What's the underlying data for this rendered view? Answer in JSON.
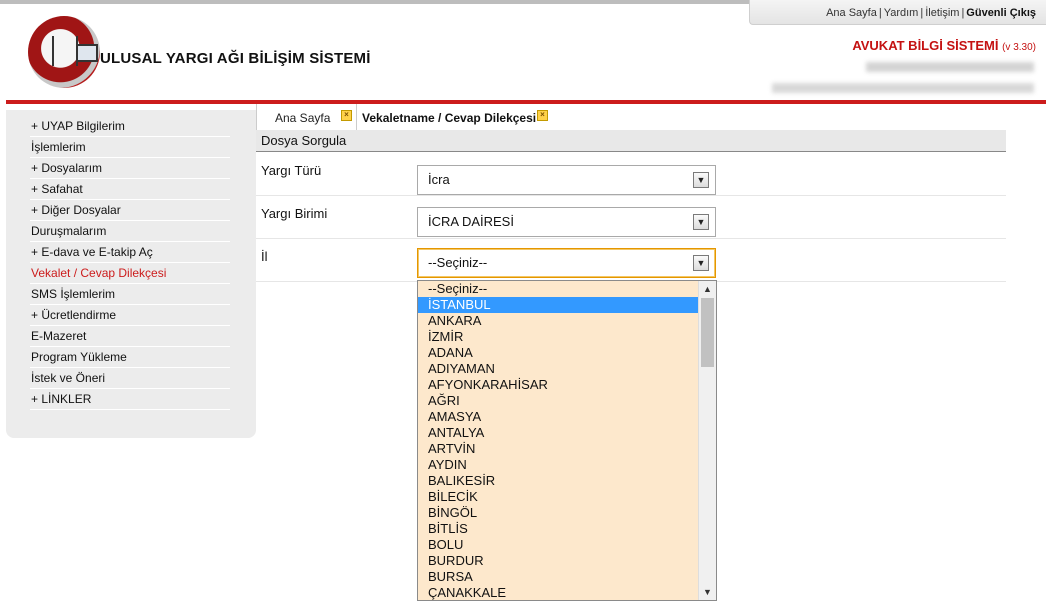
{
  "header": {
    "top_links": [
      "Ana Sayfa",
      "Yardım",
      "İletişim"
    ],
    "logout": "Güvenli Çıkış",
    "site_title": "ULUSAL YARGI AĞI BİLİŞİM SİSTEMİ",
    "app_title": "AVUKAT BİLGİ SİSTEMİ",
    "version": "(v 3.30)"
  },
  "sidebar": {
    "items": [
      "+ UYAP Bilgilerim",
      "İşlemlerim",
      "+ Dosyalarım",
      "+ Safahat",
      "+ Diğer Dosyalar",
      "Duruşmalarım",
      "+ E-dava ve E-takip Aç",
      "Vekalet / Cevap Dilekçesi",
      "SMS İşlemlerim",
      "+ Ücretlendirme",
      "E-Mazeret",
      "Program Yükleme",
      "İstek ve Öneri",
      "+ LİNKLER"
    ],
    "active_index": 7
  },
  "tabs": [
    {
      "label": "Ana Sayfa"
    },
    {
      "label": "Vekaletname / Cevap Dilekçesi"
    }
  ],
  "form": {
    "section_title": "Dosya Sorgula",
    "fields": [
      {
        "label": "Yargı Türü",
        "value": "İcra"
      },
      {
        "label": "Yargı Birimi",
        "value": "İCRA DAİRESİ"
      },
      {
        "label": "İl",
        "value": "--Seçiniz--"
      }
    ]
  },
  "dropdown": {
    "options": [
      "--Seçiniz--",
      "İSTANBUL",
      "ANKARA",
      "İZMİR",
      "ADANA",
      "ADIYAMAN",
      "AFYONKARAHİSAR",
      "AĞRI",
      "AMASYA",
      "ANTALYA",
      "ARTVİN",
      "AYDIN",
      "BALIKESİR",
      "BİLECİK",
      "BİNGÖL",
      "BİTLİS",
      "BOLU",
      "BURDUR",
      "BURSA",
      "ÇANAKKALE"
    ],
    "selected_index": 1
  },
  "colors": {
    "brand_red": "#cc1c1c",
    "dropdown_bg": "#fde8cc",
    "selection": "#3399ff"
  }
}
